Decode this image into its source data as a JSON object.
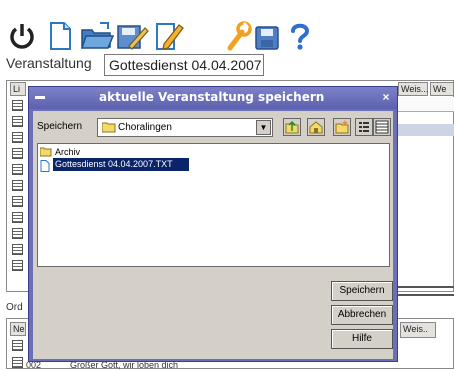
{
  "toolbar": {
    "icons": [
      "power-icon",
      "new-document-icon",
      "open-folder-icon",
      "save-edit-icon",
      "edit-icon",
      "settings-icon",
      "save-disk-icon",
      "help-icon"
    ]
  },
  "event_bar": {
    "label": "Veranstaltung",
    "value": "Gottesdienst 04.04.2007"
  },
  "background": {
    "top_list_header_left": "Li",
    "top_list_header_weis": "Weis...",
    "top_list_header_we": "We",
    "bottom_label_left": "Ord",
    "bottom_header_left": "Ne",
    "bottom_header_weis": "Weis..",
    "bottom_row_number": "002",
    "bottom_row_title": "Großer Gott, wir loben dich"
  },
  "dialog": {
    "title": "aktuelle Veranstaltung speichern",
    "save_in_label": "Speichern",
    "folder_value": "Choralingen",
    "files": [
      {
        "name": "Archiv",
        "type": "folder",
        "selected": false
      },
      {
        "name": "Gottesdienst 04.04.2007.TXT",
        "type": "file",
        "selected": true
      }
    ],
    "buttons": {
      "save": "Speichern",
      "cancel": "Abbrechen",
      "help": "Hilfe"
    }
  },
  "colors": {
    "dialog_title": "#6b6fb5",
    "selection": "#0a246a",
    "panel": "#d4d0c8"
  }
}
